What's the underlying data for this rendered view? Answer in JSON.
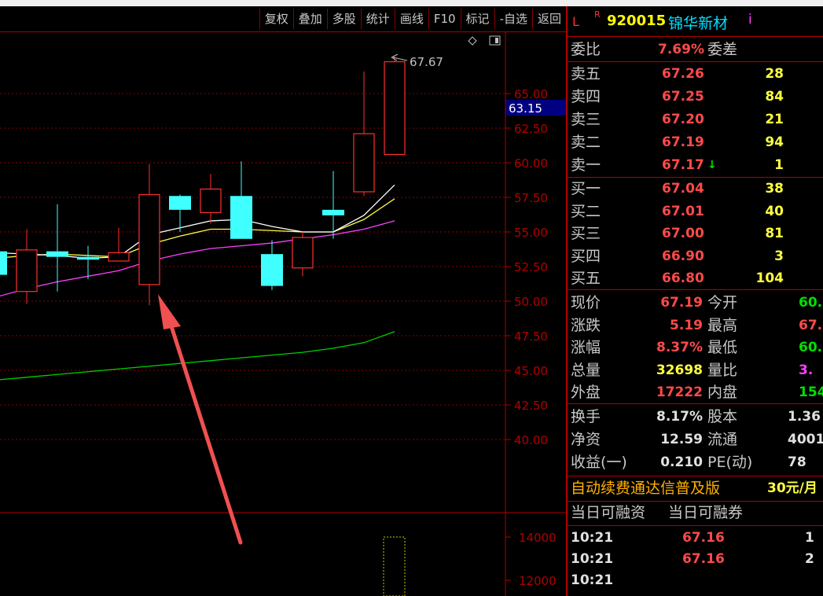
{
  "toolbar": {
    "buttons": [
      "复权",
      "叠加",
      "多股",
      "统计",
      "画线",
      "F10",
      "标记",
      "-自选",
      "返回"
    ]
  },
  "chart": {
    "price_axis": [
      "65.00",
      "62.50",
      "60.00",
      "57.50",
      "55.00",
      "52.50",
      "50.00",
      "47.50",
      "45.00",
      "42.50",
      "40.00"
    ],
    "current_price_tag": "63.15",
    "high_marker": "67.67",
    "volume_axis": [
      "14000",
      "12000"
    ],
    "colors": {
      "up": "#ff3030",
      "down": "#40ffff",
      "grid": "#8a0000",
      "ma1": "#ffffff",
      "ma2": "#ffff40",
      "ma3": "#ff40ff",
      "ma4": "#00d000",
      "arrow": "#ff5050"
    }
  },
  "chart_data": {
    "type": "candlestick",
    "ylim": [
      40,
      67.67
    ],
    "candles": [
      {
        "o": 53.6,
        "c": 51.9,
        "h": 54.0,
        "l": 51.4
      },
      {
        "o": 50.7,
        "c": 53.7,
        "h": 55.2,
        "l": 49.8
      },
      {
        "o": 53.6,
        "c": 53.2,
        "h": 57.0,
        "l": 50.7
      },
      {
        "o": 53.2,
        "c": 53.0,
        "h": 54.0,
        "l": 51.6
      },
      {
        "o": 52.9,
        "c": 53.5,
        "h": 55.3,
        "l": 52.9
      },
      {
        "o": 51.2,
        "c": 57.7,
        "h": 59.9,
        "l": 49.7
      },
      {
        "o": 57.6,
        "c": 56.6,
        "h": 57.7,
        "l": 55.0
      },
      {
        "o": 56.4,
        "c": 58.1,
        "h": 59.2,
        "l": 55.6
      },
      {
        "o": 57.6,
        "c": 54.5,
        "h": 60.1,
        "l": 54.5
      },
      {
        "o": 53.4,
        "c": 51.1,
        "h": 54.4,
        "l": 50.8
      },
      {
        "o": 52.4,
        "c": 54.6,
        "h": 55.0,
        "l": 51.8
      },
      {
        "o": 56.6,
        "c": 56.2,
        "h": 59.4,
        "l": 54.5
      },
      {
        "o": 57.9,
        "c": 62.1,
        "h": 66.6,
        "l": 57.6
      },
      {
        "o": 60.6,
        "c": 67.3,
        "h": 67.67,
        "l": 60.6
      }
    ],
    "ma_short": [
      53.5,
      53.4,
      53.3,
      53.1,
      53.2,
      54.8,
      55.3,
      55.8,
      55.9,
      55.4,
      55.0,
      55.0,
      56.2,
      58.4
    ],
    "ma_mid": [
      53.1,
      53.3,
      53.4,
      53.3,
      53.2,
      54.1,
      54.7,
      55.2,
      55.2,
      55.1,
      55.0,
      55.0,
      55.9,
      57.4
    ],
    "ma_long": [
      50.3,
      50.9,
      51.4,
      51.8,
      52.2,
      52.9,
      53.4,
      53.8,
      54.0,
      54.2,
      54.5,
      54.8,
      55.2,
      55.8
    ],
    "ma_vlong": [
      44.3,
      44.5,
      44.7,
      44.9,
      45.1,
      45.3,
      45.5,
      45.7,
      45.9,
      46.1,
      46.3,
      46.6,
      47.0,
      47.8
    ]
  },
  "stock": {
    "market_letter": "L",
    "r_flag": "R",
    "code": "920015",
    "name": "锦华新材",
    "info_icon": "i"
  },
  "weibi": {
    "label": "委比",
    "value": "7.69%",
    "label2": "委差"
  },
  "asks": [
    {
      "label": "卖五",
      "price": "67.26",
      "vol": "28"
    },
    {
      "label": "卖四",
      "price": "67.25",
      "vol": "84"
    },
    {
      "label": "卖三",
      "price": "67.20",
      "vol": "21"
    },
    {
      "label": "卖二",
      "price": "67.19",
      "vol": "94"
    },
    {
      "label": "卖一",
      "price": "67.17",
      "vol": "1",
      "arrow": "down-arrow-icon"
    }
  ],
  "bids": [
    {
      "label": "买一",
      "price": "67.04",
      "vol": "38"
    },
    {
      "label": "买二",
      "price": "67.01",
      "vol": "40"
    },
    {
      "label": "买三",
      "price": "67.00",
      "vol": "81"
    },
    {
      "label": "买四",
      "price": "66.90",
      "vol": "3"
    },
    {
      "label": "买五",
      "price": "66.80",
      "vol": "104"
    }
  ],
  "quote": [
    {
      "l1": "现价",
      "v1": "67.19",
      "l2": "今开",
      "v2": "60."
    },
    {
      "l1": "涨跌",
      "v1": "5.19",
      "l2": "最高",
      "v2": "67."
    },
    {
      "l1": "涨幅",
      "v1": "8.37%",
      "l2": "最低",
      "v2": "60."
    },
    {
      "l1": "总量",
      "v1": "32698",
      "l2": "量比",
      "v2": "3."
    },
    {
      "l1": "外盘",
      "v1": "17222",
      "l2": "内盘",
      "v2": "154"
    }
  ],
  "fundamentals": [
    {
      "l1": "换手",
      "v1": "8.17%",
      "l2": "股本",
      "v2": "1.36"
    },
    {
      "l1": "净资",
      "v1": "12.59",
      "l2": "流通",
      "v2": "4001"
    },
    {
      "l1": "收益(一)",
      "v1": "0.210",
      "l2": "PE(动)",
      "v2": "78"
    }
  ],
  "promo": {
    "text": "自动续费通达信普及版",
    "price": "30元/月"
  },
  "margin": {
    "label1": "当日可融资",
    "label2": "当日可融券"
  },
  "ticks": [
    {
      "time": "10:21",
      "price": "67.16",
      "vol": "1"
    },
    {
      "time": "10:21",
      "price": "67.16",
      "vol": "2"
    },
    {
      "time": "10:21",
      "price": "",
      "vol": ""
    }
  ]
}
